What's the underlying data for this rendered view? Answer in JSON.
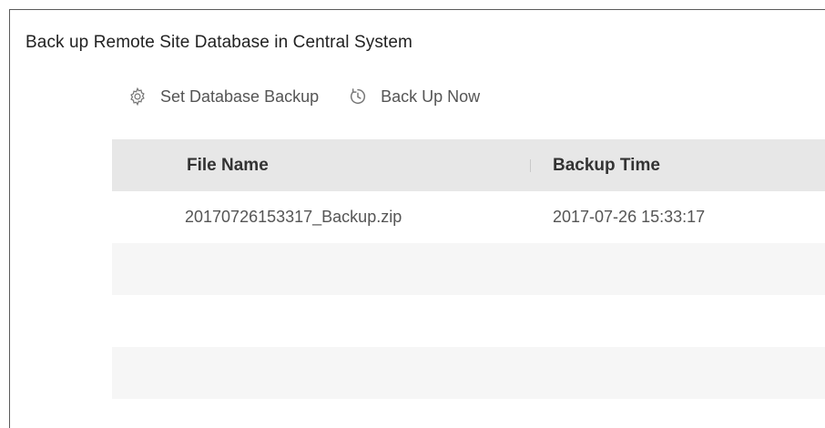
{
  "page": {
    "title": "Back up Remote Site Database in Central System"
  },
  "toolbar": {
    "set_backup": {
      "label": "Set Database Backup",
      "icon": "gear-icon"
    },
    "backup_now": {
      "label": "Back Up Now",
      "icon": "clock-refresh-icon"
    }
  },
  "table": {
    "columns": [
      "File Name",
      "Backup Time"
    ],
    "rows": [
      {
        "file_name": "20170726153317_Backup.zip",
        "backup_time": "2017-07-26 15:33:17"
      }
    ]
  },
  "colors": {
    "header_bg": "#e7e7e7",
    "alt_row_bg": "#f6f6f6",
    "frame_border": "#5a5a5a"
  }
}
